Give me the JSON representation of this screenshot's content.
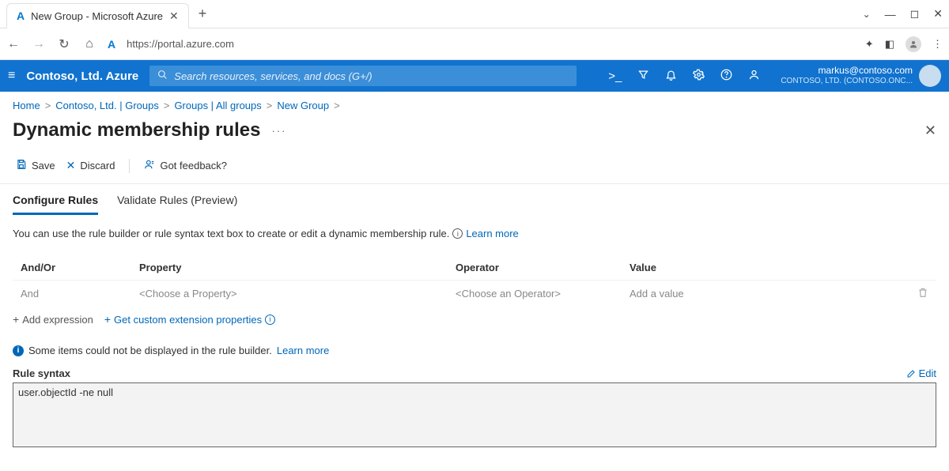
{
  "browser": {
    "tab_title": "New Group - Microsoft Azure",
    "url": "https://portal.azure.com"
  },
  "azure": {
    "brand": "Contoso, Ltd. Azure",
    "search_placeholder": "Search resources, services, and docs (G+/)",
    "user_email": "markus@contoso.com",
    "user_tenant": "CONTOSO, LTD. (CONTOSO.ONC..."
  },
  "breadcrumb": {
    "items": [
      "Home",
      "Contoso, Ltd. | Groups",
      "Groups | All groups",
      "New Group"
    ]
  },
  "page": {
    "title": "Dynamic membership rules"
  },
  "toolbar": {
    "save": "Save",
    "discard": "Discard",
    "feedback": "Got feedback?"
  },
  "tabs": {
    "configure": "Configure Rules",
    "validate": "Validate Rules (Preview)"
  },
  "description": {
    "text": "You can use the rule builder or rule syntax text box to create or edit a dynamic membership rule.",
    "learn_more": "Learn more"
  },
  "table": {
    "headers": {
      "andor": "And/Or",
      "property": "Property",
      "operator": "Operator",
      "value": "Value"
    },
    "row": {
      "andor": "And",
      "property": "<Choose a Property>",
      "operator": "<Choose an Operator>",
      "value": "Add a value"
    }
  },
  "actions": {
    "add_expr": "Add expression",
    "get_ext": "Get custom extension properties"
  },
  "warning": {
    "text": "Some items could not be displayed in the rule builder.",
    "learn_more": "Learn more"
  },
  "syntax": {
    "label": "Rule syntax",
    "edit": "Edit",
    "value": "user.objectId -ne null"
  }
}
